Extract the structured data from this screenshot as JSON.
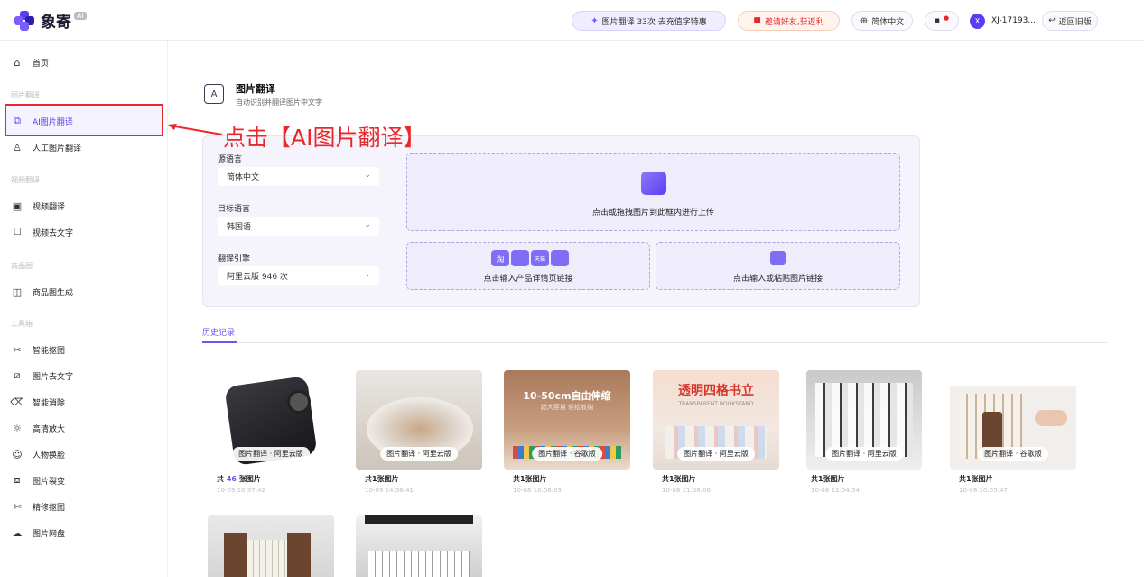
{
  "header": {
    "logo_text": "象寄",
    "logo_badge": "AI",
    "quota_pill": "图片翻译 33次 去充值字特惠",
    "invite_pill": "邀请好友,获返利",
    "lang_pill": "简体中文",
    "user_name": "XJ-17193...",
    "user_initial": "X",
    "old_version": "返回旧版"
  },
  "sidebar": {
    "home": "首页",
    "group1": "图片翻译",
    "ai_translate": "AI图片翻译",
    "human_translate": "人工图片翻译",
    "group2": "视频翻译",
    "video_translate": "视频翻译",
    "video_remove_text": "视频去文字",
    "group3": "商品图",
    "product_image": "商品图生成",
    "group4": "工具箱",
    "cutout": "智能抠图",
    "remove_text": "图片去文字",
    "erase": "智能消除",
    "upscale": "高清放大",
    "face_swap": "人物换脸",
    "split": "图片裂变",
    "fine_cutout": "精修抠图",
    "cloud_drive": "图片网盘"
  },
  "page": {
    "title": "图片翻译",
    "subtitle": "自动识别并翻译图片中文字"
  },
  "form": {
    "source_label": "源语言",
    "source_value": "简体中文",
    "target_label": "目标语言",
    "target_value": "韩国语",
    "engine_label": "翻译引擎",
    "engine_value": "阿里云版  946 次",
    "upload_text": "点击或拖拽图片到此框内进行上传",
    "product_link_text": "点击输入产品详情页链接",
    "image_link_text": "点击输入或粘贴图片链接",
    "platform_badges": [
      "淘",
      "",
      "天猫",
      ""
    ]
  },
  "history": {
    "tab_label": "历史记录",
    "cards": [
      {
        "badge": "图片翻译 · 阿里云版",
        "count_prefix": "共",
        "count": "46",
        "count_suffix": "张图片",
        "time": "10-09 10:57:42"
      },
      {
        "badge": "图片翻译 · 阿里云版",
        "count_prefix": "共",
        "count": "1",
        "count_suffix": "张图片",
        "time": "10-09 14:56:41"
      },
      {
        "badge": "图片翻译 · 谷歌版",
        "count_prefix": "共",
        "count": "1",
        "count_suffix": "张图片",
        "time": "10-08 10:58:03",
        "img_text1": "10-50cm自由伸缩",
        "img_text2": "超大容量 轻松收纳"
      },
      {
        "badge": "图片翻译 · 阿里云版",
        "count_prefix": "共",
        "count": "1",
        "count_suffix": "张图片",
        "time": "10-08 11:08:06",
        "img_text1": "透明四格书立",
        "img_text2": "TRANSPARENT BOOKSTAND"
      },
      {
        "badge": "图片翻译 · 阿里云版",
        "count_prefix": "共",
        "count": "1",
        "count_suffix": "张图片",
        "time": "10-08 11:04:54"
      },
      {
        "badge": "图片翻译 · 谷歌版",
        "count_prefix": "共",
        "count": "1",
        "count_suffix": "张图片",
        "time": "10-08 10:55:47"
      }
    ]
  },
  "annotation": {
    "text": "点击【AI图片翻译】"
  }
}
